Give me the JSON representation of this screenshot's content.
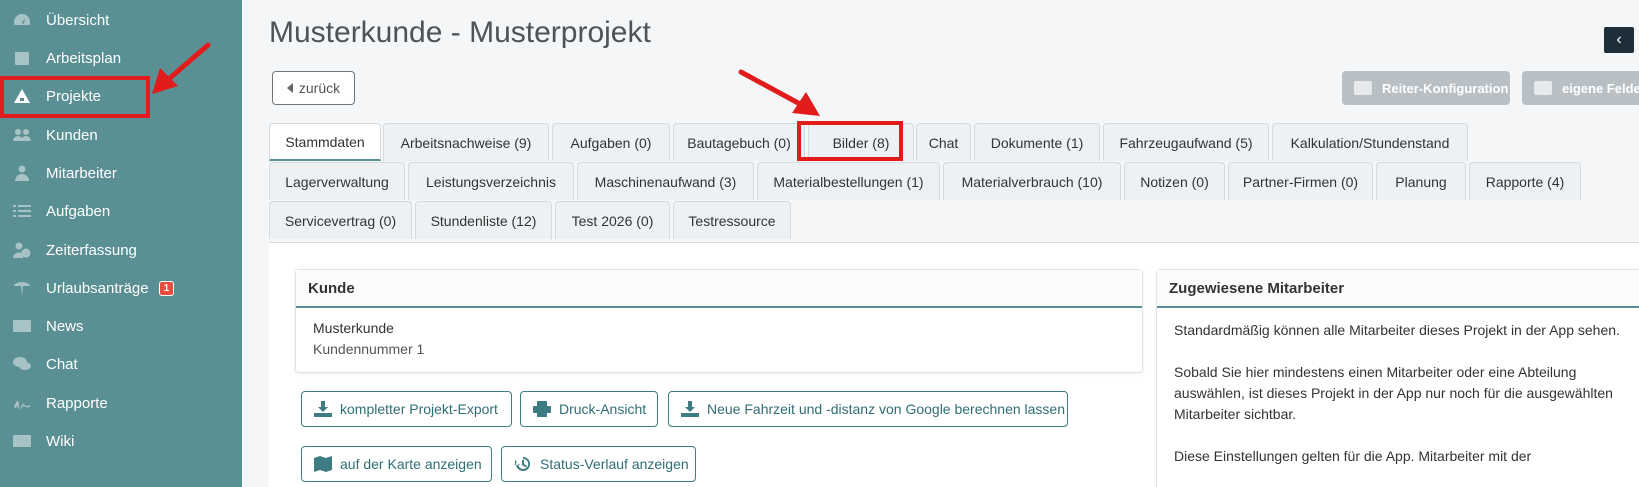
{
  "sidebar": {
    "items": [
      {
        "label": "Übersicht",
        "icon": "dashboard-icon"
      },
      {
        "label": "Arbeitsplan",
        "icon": "calendar-icon"
      },
      {
        "label": "Projekte",
        "icon": "project-icon"
      },
      {
        "label": "Kunden",
        "icon": "customers-icon"
      },
      {
        "label": "Mitarbeiter",
        "icon": "employee-icon"
      },
      {
        "label": "Aufgaben",
        "icon": "tasks-icon"
      },
      {
        "label": "Zeiterfassung",
        "icon": "time-tracking-icon"
      },
      {
        "label": "Urlaubsanträge",
        "icon": "vacation-icon",
        "badge": "1"
      },
      {
        "label": "News",
        "icon": "news-icon"
      },
      {
        "label": "Chat",
        "icon": "chat-icon"
      },
      {
        "label": "Rapporte",
        "icon": "signature-icon"
      },
      {
        "label": "Wiki",
        "icon": "wiki-icon"
      }
    ],
    "active": "Projekte"
  },
  "header": {
    "title": "Musterkunde - Musterprojekt",
    "back_label": "zurück",
    "tab_config_label": "Reiter-Konfiguration",
    "custom_fields_label": "eigene Felder",
    "collapse_icon": "chevron-left-icon"
  },
  "tabs": {
    "row1": [
      "Stammdaten",
      "Arbeitsnachweise (9)",
      "Aufgaben (0)",
      "Bautagebuch (0)",
      "Bilder (8)",
      "Chat",
      "Dokumente (1)",
      "Fahrzeugaufwand (5)",
      "Kalkulation/Stundenstand"
    ],
    "row2": [
      "Lagerverwaltung",
      "Leistungsverzeichnis",
      "Maschinenaufwand (3)",
      "Materialbestellungen (1)",
      "Materialverbrauch (10)",
      "Notizen (0)",
      "Partner-Firmen (0)",
      "Planung",
      "Rapporte (4)"
    ],
    "row3": [
      "Servicevertrag (0)",
      "Stundenliste (12)",
      "Test 2026 (0)",
      "Testressource"
    ],
    "active": "Stammdaten"
  },
  "customer_card": {
    "title": "Kunde",
    "name": "Musterkunde",
    "number": "Kundennummer 1"
  },
  "actions": {
    "export": "kompletter Projekt-Export",
    "print": "Druck-Ansicht",
    "travel": "Neue Fahrzeit und -distanz von Google berechnen lassen",
    "map": "auf der Karte anzeigen",
    "status": "Status-Verlauf anzeigen"
  },
  "employees_card": {
    "title": "Zugewiesene Mitarbeiter",
    "p1": "Standardmäßig können alle Mitarbeiter dieses Projekt in der App sehen.",
    "p2": "Sobald Sie hier mindestens einen Mitarbeiter oder eine Abteilung auswählen, ist dieses Projekt in der App nur noch für die ausgewählten Mitarbeiter sichtbar.",
    "p3": "Diese Einstellungen gelten für die App. Mitarbeiter mit der"
  },
  "annotation_color": "#e21b1b",
  "accent_color": "#5a8f94"
}
